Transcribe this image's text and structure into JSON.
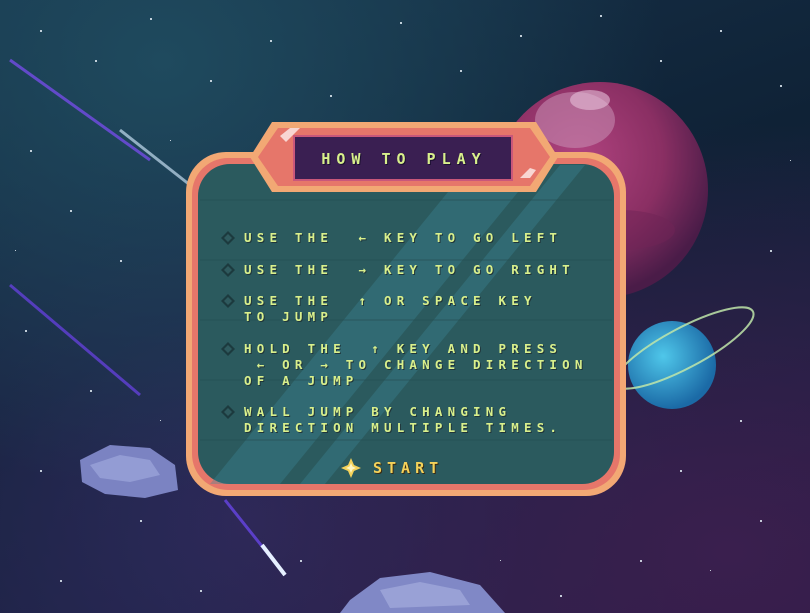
{
  "menu": {
    "title": "HOW TO PLAY",
    "instructions": [
      {
        "lines": [
          "USE THE  ← KEY TO GO LEFT"
        ]
      },
      {
        "lines": [
          "USE THE  → KEY TO GO RIGHT"
        ]
      },
      {
        "lines": [
          "USE THE  ↑ OR SPACE KEY",
          "TO JUMP"
        ]
      },
      {
        "lines": [
          "HOLD THE  ↑ KEY AND PRESS",
          " ← OR → TO CHANGE DIRECTION",
          "OF A JUMP"
        ]
      },
      {
        "lines": [
          "WALL JUMP BY CHANGING",
          "DIRECTION MULTIPLE TIMES."
        ]
      }
    ],
    "start_label": "START"
  },
  "colors": {
    "text": "#d9f08c",
    "start_text": "#f4d25a",
    "panel_border": "#e7925e",
    "panel_fill": "#2b5a5e",
    "title_fill": "#3a1f52"
  },
  "icons": [
    "diamond-bullet-icon",
    "sparkle-icon"
  ]
}
